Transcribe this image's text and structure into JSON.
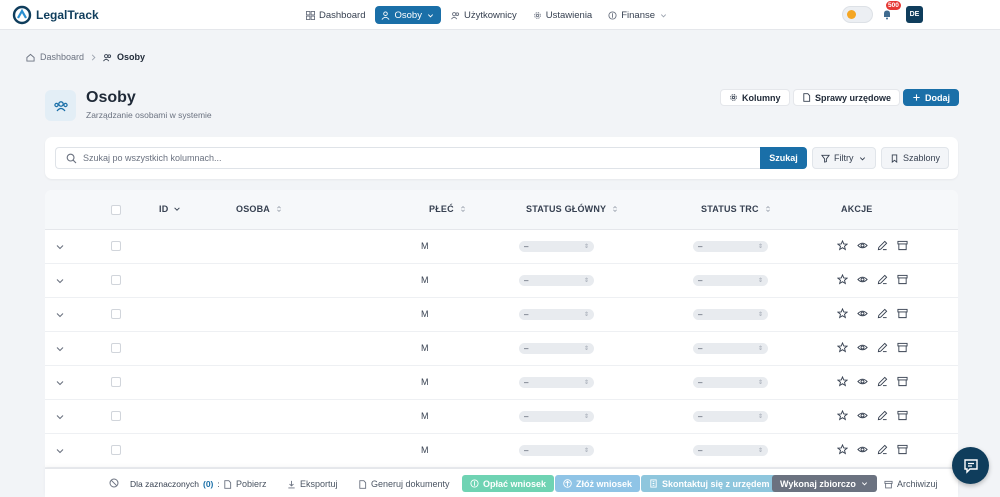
{
  "app": {
    "logo_text": "LegalTrack"
  },
  "nav": {
    "items": [
      {
        "label": "Dashboard",
        "icon": "grid-icon"
      },
      {
        "label": "Osoby",
        "icon": "user-icon",
        "active": true
      },
      {
        "label": "Użytkownicy",
        "icon": "users-icon"
      },
      {
        "label": "Ustawienia",
        "icon": "gear-icon"
      },
      {
        "label": "Finanse",
        "icon": "dollar-icon"
      }
    ],
    "notification_count": "500",
    "avatar_initials": "DE"
  },
  "breadcrumb": {
    "home": "Dashboard",
    "current": "Osoby"
  },
  "header": {
    "title": "Osoby",
    "subtitle": "Zarządzanie osobami w systemie",
    "columns_label": "Kolumny",
    "cases_label": "Sprawy urzędowe",
    "add_label": "Dodaj"
  },
  "search": {
    "placeholder": "Szukaj po wszystkich kolumnach...",
    "button_label": "Szukaj",
    "filters_label": "Filtry",
    "templates_label": "Szablony"
  },
  "table": {
    "columns": [
      "ID",
      "OSOBA",
      "PŁEĆ",
      "STATUS GŁÓWNY",
      "STATUS TRC",
      "AKCJE"
    ],
    "rows": [
      {
        "gender": "M",
        "status_main": "–",
        "status_trc": "–"
      },
      {
        "gender": "M",
        "status_main": "–",
        "status_trc": "–"
      },
      {
        "gender": "M",
        "status_main": "–",
        "status_trc": "–"
      },
      {
        "gender": "M",
        "status_main": "–",
        "status_trc": "–"
      },
      {
        "gender": "M",
        "status_main": "–",
        "status_trc": "–"
      },
      {
        "gender": "M",
        "status_main": "–",
        "status_trc": "–"
      },
      {
        "gender": "M",
        "status_main": "–",
        "status_trc": "–"
      }
    ]
  },
  "bulk": {
    "selected_label": "Dla zaznaczonych",
    "selected_count": "(0)",
    "selected_suffix": ":",
    "download": "Pobierz",
    "export": "Eksportuj",
    "generate": "Generuj dokumenty",
    "pay": "Opłać wniosek",
    "submit": "Złóż wniosek",
    "contact": "Skontaktuj się z urzędem",
    "bulk_action": "Wykonaj zbiorczo",
    "archive": "Archiwizuj"
  },
  "colors": {
    "primary": "#1a6fa8",
    "green_chip": "#6fd3b3",
    "blue_chip": "#8fc4e6",
    "teal_chip": "#8ec6dd",
    "gray_chip": "#6b7280"
  }
}
